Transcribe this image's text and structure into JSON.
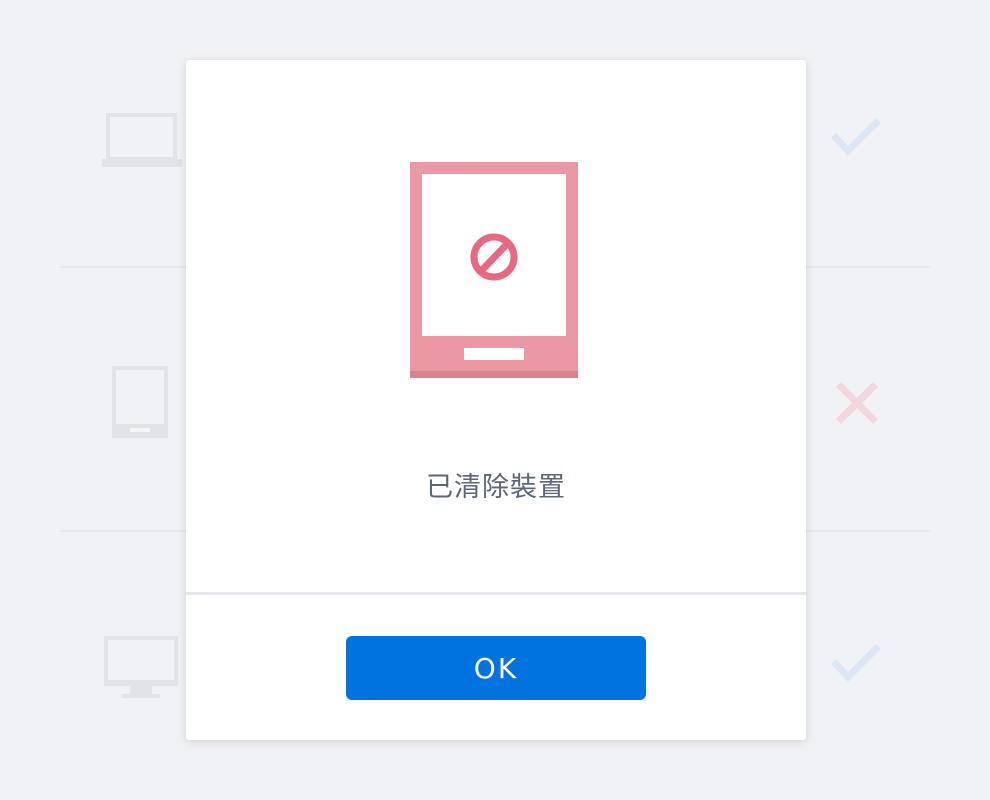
{
  "background": {
    "devices": [
      {
        "icon": "laptop-icon",
        "status": "check-icon"
      },
      {
        "icon": "tablet-icon",
        "status": "cross-icon"
      },
      {
        "icon": "monitor-icon",
        "status": "check-icon"
      }
    ]
  },
  "dialog": {
    "illustration_icon": "blocked-tablet-icon",
    "message": "已清除裝置",
    "ok_label": "OK"
  },
  "colors": {
    "page_background": "#f0f2f5",
    "accent": "#0073e0",
    "danger": "#e8697e",
    "illustration": "#eb98a5",
    "muted_icon": "#e1e3e7",
    "check_faded": "#dce6f5",
    "cross_faded": "#f2d8de",
    "message_text": "#5b6676"
  }
}
